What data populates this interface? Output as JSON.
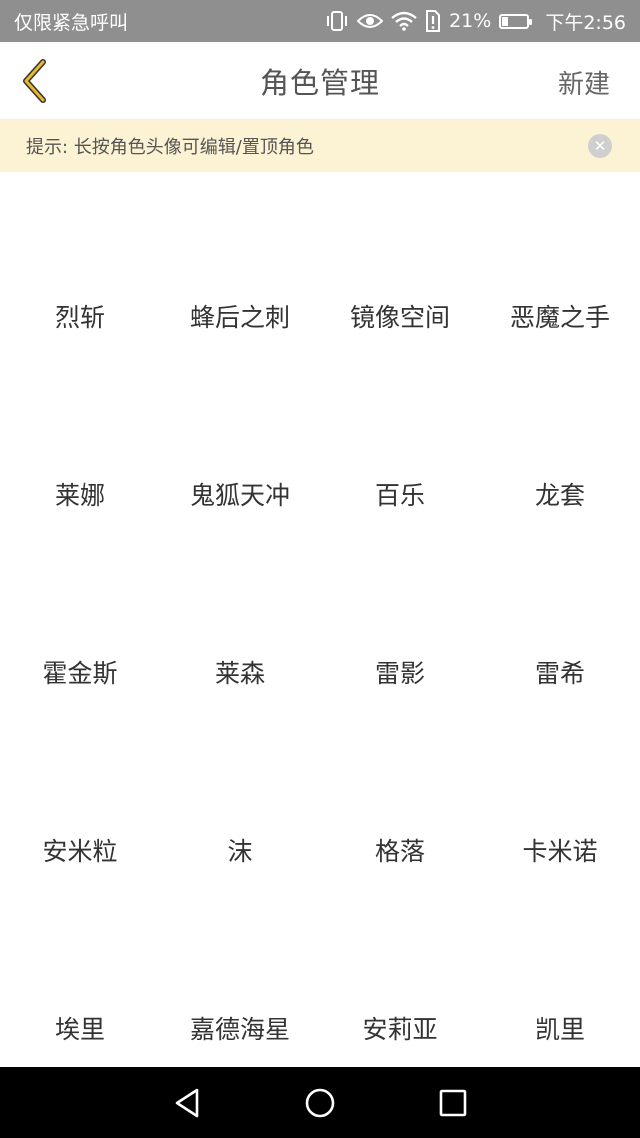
{
  "status_bar": {
    "carrier_text": "仅限紧急呼叫",
    "battery_text": "21%",
    "battery_level": 0.21,
    "time": "下午2:56",
    "icons": [
      "vibrate-icon",
      "eye-icon",
      "wifi-icon",
      "sim-alert-icon",
      "battery-icon"
    ]
  },
  "nav": {
    "title": "角色管理",
    "new_label": "新建",
    "back_icon": "chevron-left-icon",
    "accent": "#e8b72b"
  },
  "tip": {
    "text": "提示: 长按角色头像可编辑/置顶角色",
    "close_icon": "close-icon",
    "close_glyph": "✕"
  },
  "roles": [
    {
      "name": "烈斩",
      "bg": "#ffffff",
      "hair": "#9be63a",
      "face": "#fbefe4",
      "cloth": "#f2f2f2"
    },
    {
      "name": "蜂后之刺",
      "bg": "#f3f3f3",
      "hair": "#6b6b6b",
      "face": "#f8e8dc",
      "cloth": "#f0a020"
    },
    {
      "name": "镜像空间",
      "bg": "#ffffff",
      "hair": "#e8e8e8",
      "face": "#fbefe4",
      "cloth": "#2f8f45"
    },
    {
      "name": "恶魔之手",
      "bg": "#ffffff",
      "hair": "#3c3c4c",
      "face": "#f7e6dc",
      "cloth": "#3c3c4c"
    },
    {
      "name": "莱娜",
      "bg": "#2c5a66",
      "hair": "#2f6b78",
      "face": "#5aa49a",
      "cloth": "#244a55"
    },
    {
      "name": "鬼狐天冲",
      "bg": "#eeeaf3",
      "hair": "#8b79a8",
      "face": "#f6ecec",
      "cloth": "#5a5070"
    },
    {
      "name": "百乐",
      "bg": "#6b57a8",
      "hair": "#f1eef6",
      "face": "#fbefee",
      "cloth": "#2c2c36"
    },
    {
      "name": "龙套",
      "bg": "#c9d1e8",
      "hair": "#eef1f8",
      "face": "#eef1f8",
      "cloth": "#eef1f8",
      "placeholder": true
    },
    {
      "name": "霍金斯",
      "bg": "#486a58",
      "hair": "#1f1f2c",
      "face": "#f3e2da",
      "cloth": "#2f4a86"
    },
    {
      "name": "莱森",
      "bg": "#ffffff",
      "hair": "#ffffff",
      "face": "#ffffff",
      "cloth": "#ffffff",
      "sketch": true
    },
    {
      "name": "雷影",
      "bg": "#f4e8e0",
      "hair": "#8d8d9c",
      "face": "#fbeee4",
      "cloth": "#c07a3c"
    },
    {
      "name": "雷希",
      "bg": "#f8f0ea",
      "hair": "#7b7b8a",
      "face": "#fbefe6",
      "cloth": "#d9c8b8"
    },
    {
      "name": "安米粒",
      "bg": "#f5e9df",
      "hair": "#b06a3c",
      "face": "#fbeee2",
      "cloth": "#a06038"
    },
    {
      "name": "沫",
      "bg": "#fbeede",
      "hair": "#f1c98a",
      "face": "#fbefe4",
      "cloth": "#f2d8b0"
    },
    {
      "name": "格落",
      "bg": "#f3f3f3",
      "hair": "#ececec",
      "face": "#fbefe6",
      "cloth": "#3a3a3a"
    },
    {
      "name": "卡米诺",
      "bg": "#48a060",
      "hair": "#2c2c2c",
      "face": "#f6e4d8",
      "cloth": "#c8282c"
    },
    {
      "name": "埃里",
      "bg": "#ffffff",
      "hair": "#b7bcc6",
      "face": "#fbefe8",
      "cloth": "#4d78c8"
    },
    {
      "name": "嘉德海星",
      "bg": "#3a2a2a",
      "hair": "#f1d23a",
      "face": "#fbf0d8",
      "cloth": "#f1d23a"
    },
    {
      "name": "安莉亚",
      "bg": "#ffffff",
      "hair": "#52c4b0",
      "face": "#fbefe4",
      "cloth": "#52c4b0"
    },
    {
      "name": "凯里",
      "bg": "#fbe8ee",
      "hair": "#e9a6b8",
      "face": "#fbf0ee",
      "cloth": "#e98aa8"
    }
  ],
  "android_nav": {
    "back_icon": "triangle-back-icon",
    "home_icon": "circle-home-icon",
    "recents_icon": "square-recents-icon"
  }
}
